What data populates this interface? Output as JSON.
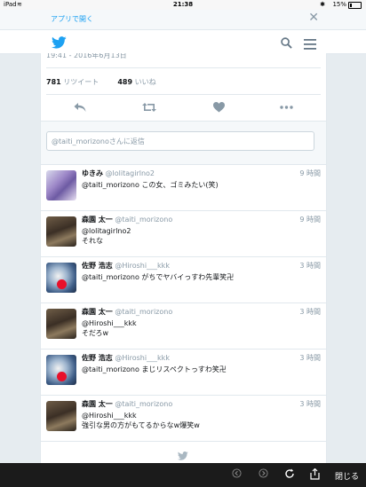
{
  "status_bar": {
    "device": "iPad",
    "time": "21:38",
    "battery": "15%"
  },
  "app_banner": {
    "open_label": "アプリで開く",
    "close_glyph": "✕"
  },
  "tweet_detail": {
    "timestamp": "19:41 - 2016年6月13日",
    "retweets_count": "781",
    "retweets_label": "リツイート",
    "likes_count": "489",
    "likes_label": "いいね"
  },
  "reply_box": {
    "placeholder": "@taiti_morizonoさんに返信"
  },
  "replies": [
    {
      "name": "ゆきみ",
      "handle": "@lolitagirlno2",
      "time": "9 時間",
      "line1": "@taiti_morizono この女、ゴミみたい(笑)",
      "line2": "",
      "avatar": "pink"
    },
    {
      "name": "森園 太一",
      "handle": "@taiti_morizono",
      "time": "9 時間",
      "line1": "@lolitagirlno2",
      "line2": "それな",
      "avatar": "man"
    },
    {
      "name": "佐野 浩志",
      "handle": "@Hiroshi___kkk",
      "time": "3 時間",
      "line1": "@taiti_morizono がちでヤバイっすわ先輩笑卍",
      "line2": "",
      "avatar": "blue"
    },
    {
      "name": "森園 太一",
      "handle": "@taiti_morizono",
      "time": "3 時間",
      "line1": "@Hiroshi___kkk",
      "line2": "そだろw",
      "avatar": "man"
    },
    {
      "name": "佐野 浩志",
      "handle": "@Hiroshi___kkk",
      "time": "3 時間",
      "line1": "@taiti_morizono まじリスペクトっすわ笑卍",
      "line2": "",
      "avatar": "blue"
    },
    {
      "name": "森園 太一",
      "handle": "@taiti_morizono",
      "time": "3 時間",
      "line1": "@Hiroshi___kkk",
      "line2": "強引な男の方がもてるからなw爆笑w",
      "avatar": "man"
    }
  ],
  "browser_bar": {
    "close_label": "閉じる"
  },
  "colors": {
    "accent": "#1da1f2",
    "muted": "#8899a6",
    "browser_bar": "#1b1b1b"
  },
  "icons": [
    "twitter-bird-icon",
    "search-icon",
    "menu-icon",
    "reply-icon",
    "retweet-icon",
    "like-icon",
    "more-icon",
    "back-icon",
    "forward-icon",
    "reload-icon",
    "share-icon"
  ]
}
